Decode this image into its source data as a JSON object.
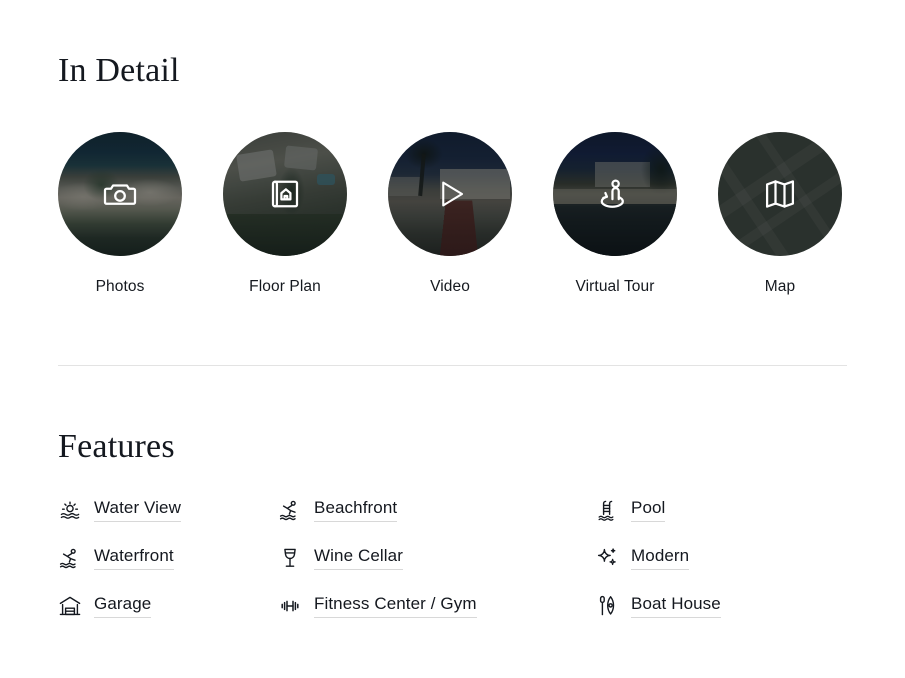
{
  "in_detail": {
    "title": "In Detail",
    "items": [
      {
        "label": "Photos",
        "icon": "camera-icon",
        "scene": "beach"
      },
      {
        "label": "Floor Plan",
        "icon": "floor-plan-icon",
        "scene": "aerial"
      },
      {
        "label": "Video",
        "icon": "play-icon",
        "scene": "drive"
      },
      {
        "label": "Virtual Tour",
        "icon": "360-person-icon",
        "scene": "shore"
      },
      {
        "label": "Map",
        "icon": "folded-map-icon",
        "scene": "map"
      }
    ]
  },
  "features": {
    "title": "Features",
    "items": [
      {
        "label": "Water View",
        "icon": "sunset-water-icon"
      },
      {
        "label": "Beachfront",
        "icon": "swimmer-icon"
      },
      {
        "label": "Pool",
        "icon": "pool-ladder-icon"
      },
      {
        "label": "Waterfront",
        "icon": "swimmer-icon"
      },
      {
        "label": "Wine Cellar",
        "icon": "wine-glass-icon"
      },
      {
        "label": "Modern",
        "icon": "sparkle-icon"
      },
      {
        "label": "Garage",
        "icon": "garage-icon"
      },
      {
        "label": "Fitness Center / Gym",
        "icon": "dumbbell-icon"
      },
      {
        "label": "Boat House",
        "icon": "rowboat-paddle-icon"
      }
    ]
  },
  "colors": {
    "text": "#14181f",
    "divider": "#e3e3e3",
    "underline": "#d8d8d8",
    "map_background": "#434a40",
    "overlay_icon": "#ffffff"
  }
}
